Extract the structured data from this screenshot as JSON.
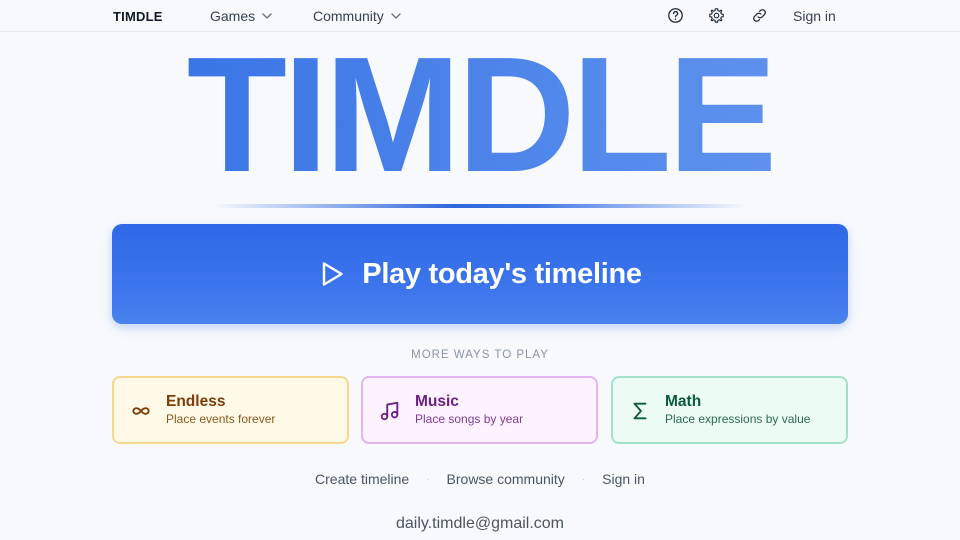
{
  "nav": {
    "brand": "TIMDLE",
    "games_label": "Games",
    "community_label": "Community",
    "signin_label": "Sign in",
    "icons": [
      "help-circle-icon",
      "gear-icon",
      "link-icon"
    ]
  },
  "hero": {
    "title": "TIMDLE",
    "play_label": "Play today's timeline"
  },
  "more_ways": {
    "heading": "MORE WAYS TO PLAY",
    "modes": [
      {
        "title": "Endless",
        "subtitle": "Place events forever",
        "icon": "infinity-icon",
        "color": "#7c3d08"
      },
      {
        "title": "Music",
        "subtitle": "Place songs by year",
        "icon": "music-note-icon",
        "color": "#6b1f86"
      },
      {
        "title": "Math",
        "subtitle": "Place expressions by value",
        "icon": "sigma-icon",
        "color": "#0c5a3d"
      }
    ]
  },
  "footer": {
    "links": [
      "Create timeline",
      "Browse community",
      "Sign in"
    ],
    "email": "daily.timdle@gmail.com"
  },
  "colors": {
    "accent": "#2f68e6",
    "background": "#f7f9fc"
  }
}
